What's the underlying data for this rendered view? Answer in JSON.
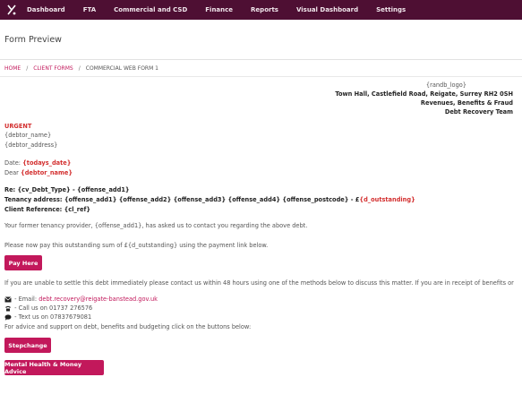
{
  "nav": {
    "items": [
      "Dashboard",
      "FTA",
      "Commercial and CSD",
      "Finance",
      "Reports",
      "Visual Dashboard",
      "Settings"
    ]
  },
  "page": {
    "title": "Form Preview"
  },
  "breadcrumb": {
    "home": "HOME",
    "forms": "CLIENT FORMS",
    "current": "COMMERCIAL WEB FORM 1"
  },
  "letter": {
    "logo_placeholder": "{randb_logo}",
    "address_line": "Town Hall, Castlefield Road, Reigate, Surrey RH2 0SH",
    "dept": "Revenues, Benefits & Fraud",
    "team": "Debt Recovery Team",
    "urgent": "URGENT",
    "debtor_name": "{debtor_name}",
    "debtor_address": "{debtor_address}",
    "date_label": "Date:",
    "date_value": "{todays_date}",
    "dear_label": "Dear",
    "dear_value": "{debtor_name}",
    "re_line": "Re: {cv_Debt_Type} - {offense_add1}",
    "tenancy_line": "Tenancy address: {offense_add1} {offense_add2} {offense_add3} {offense_add4} {offense_postcode} - £",
    "tenancy_amount": "{d_outstanding}",
    "client_ref": "Client Reference: {cl_ref}",
    "para1": "Your former tenancy provider, {offense_add1}, has asked us to contact you regarding the above debt.",
    "para2": "Please now pay this outstanding sum of £{d_outstanding} using the payment link below.",
    "pay_button": "Pay Here",
    "para3": "If you are unable to settle this debt immediately please contact us within 48 hours using one of the methods below to discuss this matter. If you are in receipt of benefits or",
    "email_label": "- Email:",
    "email_value": "debt.recovery@reigate-banstead.gov.uk",
    "call_text": "- Call us on 01737 276576",
    "text_text": "- Text us on 07837679081",
    "advice_text": "For advice and support on debt, benefits and budgeting click on the buttons below:",
    "stepchange_button": "Stepchange",
    "mental_health_button": "Mental Health & Money Advice"
  },
  "icons": [
    "logo-icon",
    "email-icon",
    "phone-icon",
    "chat-icon"
  ],
  "colors": {
    "nav_bg": "#4e0f33",
    "accent": "#c2185b",
    "red": "#d32f2f"
  }
}
